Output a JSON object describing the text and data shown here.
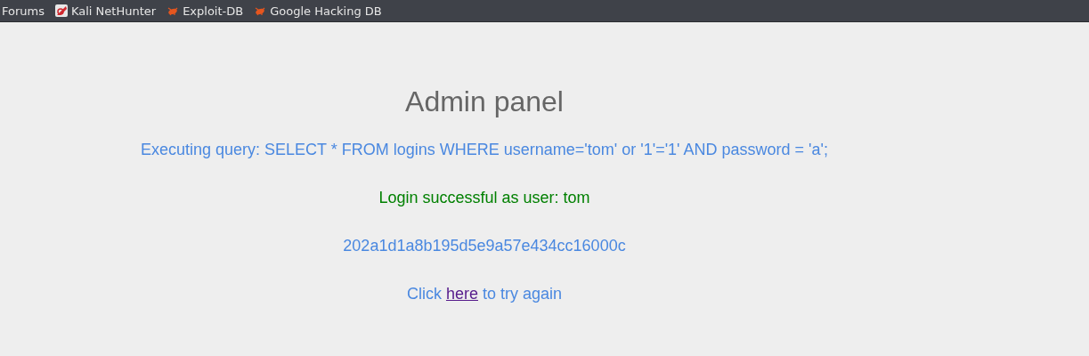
{
  "bookmarks": [
    {
      "label": "Forums",
      "kind": "plain"
    },
    {
      "label": "Kali NetHunter",
      "kind": "kali"
    },
    {
      "label": "Exploit-DB",
      "kind": "bug"
    },
    {
      "label": "Google Hacking DB",
      "kind": "bug"
    }
  ],
  "title": "Admin panel",
  "messages": [
    {
      "text": "Executing query: SELECT * FROM logins WHERE username='tom' or '1'='1' AND password = 'a';",
      "kind": "info"
    },
    {
      "text": "Login successful as user: tom",
      "kind": "success"
    },
    {
      "text": "202a1d1a8b195d5e9a57e434cc16000c",
      "kind": "info"
    }
  ],
  "retry": {
    "before": "Click",
    "link": "here",
    "after": "to try again"
  }
}
